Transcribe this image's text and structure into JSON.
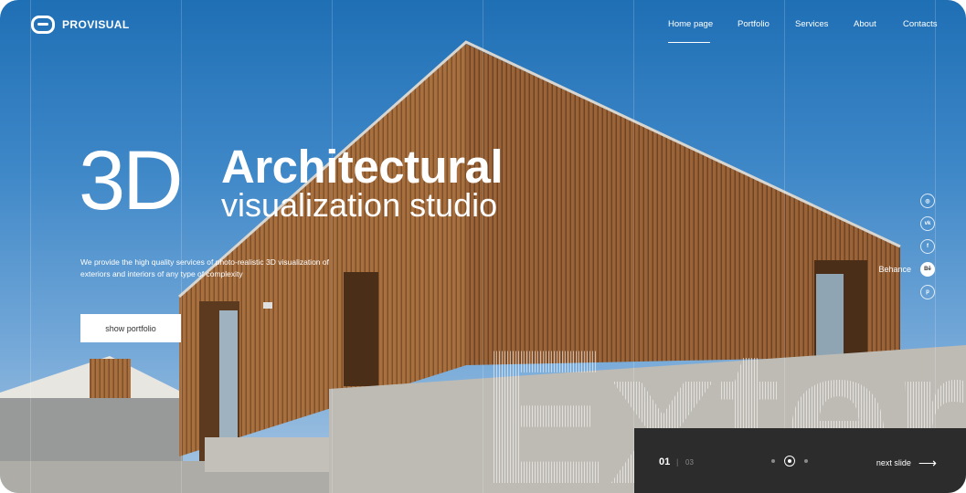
{
  "brand": {
    "name": "PROVISUAL"
  },
  "nav": {
    "items": [
      {
        "label": "Home page",
        "active": true
      },
      {
        "label": "Portfolio",
        "active": false
      },
      {
        "label": "Services",
        "active": false
      },
      {
        "label": "About",
        "active": false
      },
      {
        "label": "Contacts",
        "active": false
      }
    ]
  },
  "hero": {
    "big": "3D",
    "title": "Architectural",
    "subtitle": "visualization studio",
    "description": "We provide the high quality services of photo-realistic 3D visualization of exteriors and interiors of any type of complexity",
    "cta_label": "show portfolio"
  },
  "social": {
    "hover_label": "Behance",
    "items": [
      {
        "icon": "instagram-icon",
        "glyph": "◎"
      },
      {
        "icon": "vk-icon",
        "glyph": "vk"
      },
      {
        "icon": "facebook-icon",
        "glyph": "f"
      },
      {
        "icon": "behance-icon",
        "glyph": "Bē"
      },
      {
        "icon": "pinterest-icon",
        "glyph": "p"
      }
    ]
  },
  "background_word": "Exter",
  "slider": {
    "current": "01",
    "separator": "|",
    "total": "03",
    "next_label": "next slide",
    "arrow": "⟶"
  },
  "colors": {
    "sky": "#2f7cc0",
    "wood": "#a86d3d",
    "concrete": "#bdbab4",
    "slider_bg": "#2c2c2c"
  }
}
